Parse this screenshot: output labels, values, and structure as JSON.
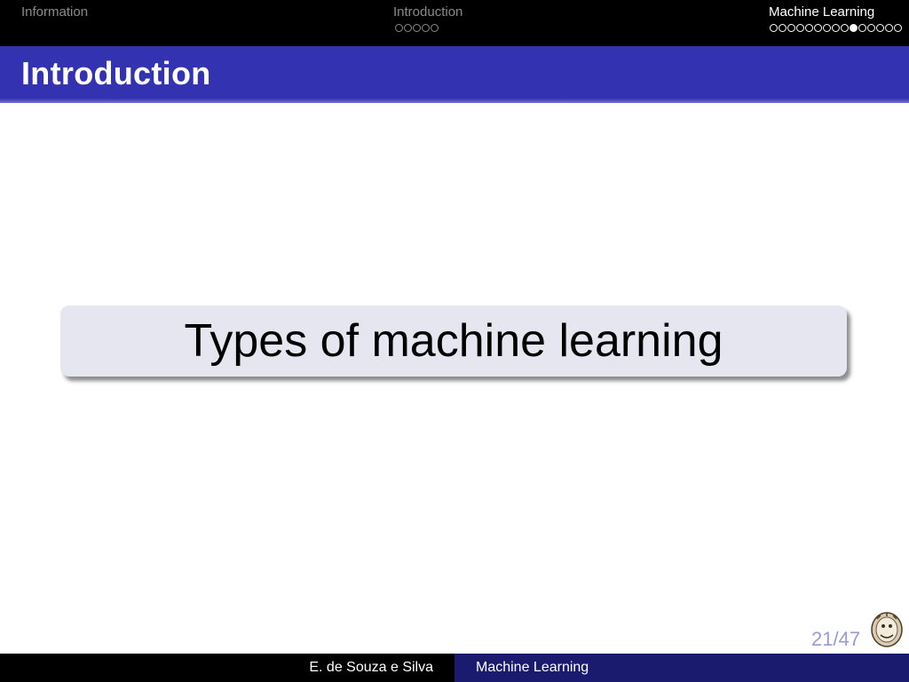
{
  "navigation": {
    "sections": [
      {
        "label": "Information",
        "frames": 0,
        "current": -1,
        "active": false
      },
      {
        "label": "Introduction",
        "frames": 5,
        "current": -1,
        "active": false
      },
      {
        "label": "Machine Learning",
        "frames": 15,
        "current": 9,
        "active": true
      }
    ]
  },
  "frame": {
    "title": "Introduction"
  },
  "content": {
    "section_box_text": "Types of machine learning"
  },
  "page": {
    "counter": "21/47"
  },
  "footer": {
    "author": "E. de Souza e Silva",
    "title": "Machine Learning"
  },
  "colors": {
    "title_bar": "#3333b2",
    "box_bg": "#e6e6f1",
    "footer_right": "#1a1a6e",
    "inactive_nav": "#8a8a8a"
  }
}
